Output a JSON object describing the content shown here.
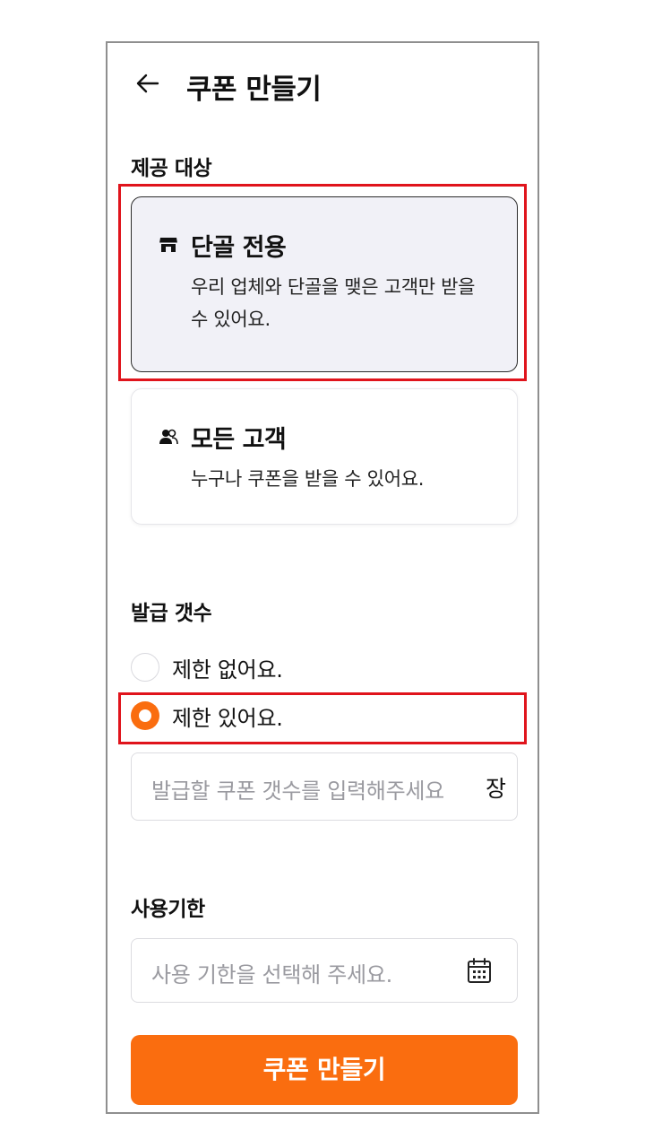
{
  "header": {
    "back_icon": "arrow-left-icon",
    "title": "쿠폰 만들기"
  },
  "target": {
    "label": "제공 대상",
    "options": [
      {
        "icon": "storefront-icon",
        "title": "단골 전용",
        "desc": "우리 업체와 단골을 맺은 고객만 받을 수 있어요.",
        "selected": true
      },
      {
        "icon": "people-icon",
        "title": "모든 고객",
        "desc": "누구나 쿠폰을 받을 수 있어요.",
        "selected": false
      }
    ]
  },
  "issue": {
    "label": "발급 갯수",
    "options": [
      {
        "label": "제한 없어요.",
        "selected": false
      },
      {
        "label": "제한 있어요.",
        "selected": true
      }
    ],
    "count_input": {
      "placeholder": "발급할 쿠폰 갯수를 입력해주세요",
      "value": "",
      "unit": "장"
    }
  },
  "expiry": {
    "label": "사용기한",
    "placeholder": "사용 기한을 선택해 주세요.",
    "icon": "calendar-icon"
  },
  "submit": {
    "label": "쿠폰 만들기"
  },
  "colors": {
    "accent": "#fa6d0f",
    "highlight": "#e0141c",
    "selected_card_bg": "#f1f1f7"
  }
}
